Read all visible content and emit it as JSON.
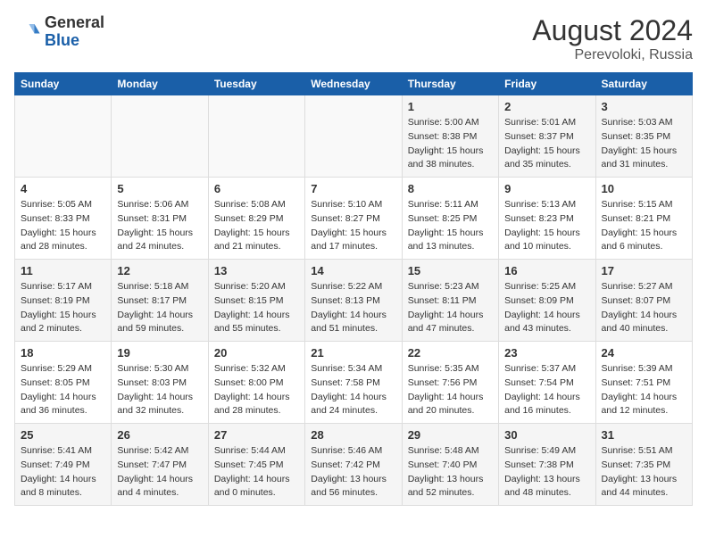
{
  "logo": {
    "text_general": "General",
    "text_blue": "Blue"
  },
  "title": {
    "month_year": "August 2024",
    "location": "Perevoloki, Russia"
  },
  "days_of_week": [
    "Sunday",
    "Monday",
    "Tuesday",
    "Wednesday",
    "Thursday",
    "Friday",
    "Saturday"
  ],
  "weeks": [
    [
      {
        "day": "",
        "info": ""
      },
      {
        "day": "",
        "info": ""
      },
      {
        "day": "",
        "info": ""
      },
      {
        "day": "",
        "info": ""
      },
      {
        "day": "1",
        "info": "Sunrise: 5:00 AM\nSunset: 8:38 PM\nDaylight: 15 hours\nand 38 minutes."
      },
      {
        "day": "2",
        "info": "Sunrise: 5:01 AM\nSunset: 8:37 PM\nDaylight: 15 hours\nand 35 minutes."
      },
      {
        "day": "3",
        "info": "Sunrise: 5:03 AM\nSunset: 8:35 PM\nDaylight: 15 hours\nand 31 minutes."
      }
    ],
    [
      {
        "day": "4",
        "info": "Sunrise: 5:05 AM\nSunset: 8:33 PM\nDaylight: 15 hours\nand 28 minutes."
      },
      {
        "day": "5",
        "info": "Sunrise: 5:06 AM\nSunset: 8:31 PM\nDaylight: 15 hours\nand 24 minutes."
      },
      {
        "day": "6",
        "info": "Sunrise: 5:08 AM\nSunset: 8:29 PM\nDaylight: 15 hours\nand 21 minutes."
      },
      {
        "day": "7",
        "info": "Sunrise: 5:10 AM\nSunset: 8:27 PM\nDaylight: 15 hours\nand 17 minutes."
      },
      {
        "day": "8",
        "info": "Sunrise: 5:11 AM\nSunset: 8:25 PM\nDaylight: 15 hours\nand 13 minutes."
      },
      {
        "day": "9",
        "info": "Sunrise: 5:13 AM\nSunset: 8:23 PM\nDaylight: 15 hours\nand 10 minutes."
      },
      {
        "day": "10",
        "info": "Sunrise: 5:15 AM\nSunset: 8:21 PM\nDaylight: 15 hours\nand 6 minutes."
      }
    ],
    [
      {
        "day": "11",
        "info": "Sunrise: 5:17 AM\nSunset: 8:19 PM\nDaylight: 15 hours\nand 2 minutes."
      },
      {
        "day": "12",
        "info": "Sunrise: 5:18 AM\nSunset: 8:17 PM\nDaylight: 14 hours\nand 59 minutes."
      },
      {
        "day": "13",
        "info": "Sunrise: 5:20 AM\nSunset: 8:15 PM\nDaylight: 14 hours\nand 55 minutes."
      },
      {
        "day": "14",
        "info": "Sunrise: 5:22 AM\nSunset: 8:13 PM\nDaylight: 14 hours\nand 51 minutes."
      },
      {
        "day": "15",
        "info": "Sunrise: 5:23 AM\nSunset: 8:11 PM\nDaylight: 14 hours\nand 47 minutes."
      },
      {
        "day": "16",
        "info": "Sunrise: 5:25 AM\nSunset: 8:09 PM\nDaylight: 14 hours\nand 43 minutes."
      },
      {
        "day": "17",
        "info": "Sunrise: 5:27 AM\nSunset: 8:07 PM\nDaylight: 14 hours\nand 40 minutes."
      }
    ],
    [
      {
        "day": "18",
        "info": "Sunrise: 5:29 AM\nSunset: 8:05 PM\nDaylight: 14 hours\nand 36 minutes."
      },
      {
        "day": "19",
        "info": "Sunrise: 5:30 AM\nSunset: 8:03 PM\nDaylight: 14 hours\nand 32 minutes."
      },
      {
        "day": "20",
        "info": "Sunrise: 5:32 AM\nSunset: 8:00 PM\nDaylight: 14 hours\nand 28 minutes."
      },
      {
        "day": "21",
        "info": "Sunrise: 5:34 AM\nSunset: 7:58 PM\nDaylight: 14 hours\nand 24 minutes."
      },
      {
        "day": "22",
        "info": "Sunrise: 5:35 AM\nSunset: 7:56 PM\nDaylight: 14 hours\nand 20 minutes."
      },
      {
        "day": "23",
        "info": "Sunrise: 5:37 AM\nSunset: 7:54 PM\nDaylight: 14 hours\nand 16 minutes."
      },
      {
        "day": "24",
        "info": "Sunrise: 5:39 AM\nSunset: 7:51 PM\nDaylight: 14 hours\nand 12 minutes."
      }
    ],
    [
      {
        "day": "25",
        "info": "Sunrise: 5:41 AM\nSunset: 7:49 PM\nDaylight: 14 hours\nand 8 minutes."
      },
      {
        "day": "26",
        "info": "Sunrise: 5:42 AM\nSunset: 7:47 PM\nDaylight: 14 hours\nand 4 minutes."
      },
      {
        "day": "27",
        "info": "Sunrise: 5:44 AM\nSunset: 7:45 PM\nDaylight: 14 hours\nand 0 minutes."
      },
      {
        "day": "28",
        "info": "Sunrise: 5:46 AM\nSunset: 7:42 PM\nDaylight: 13 hours\nand 56 minutes."
      },
      {
        "day": "29",
        "info": "Sunrise: 5:48 AM\nSunset: 7:40 PM\nDaylight: 13 hours\nand 52 minutes."
      },
      {
        "day": "30",
        "info": "Sunrise: 5:49 AM\nSunset: 7:38 PM\nDaylight: 13 hours\nand 48 minutes."
      },
      {
        "day": "31",
        "info": "Sunrise: 5:51 AM\nSunset: 7:35 PM\nDaylight: 13 hours\nand 44 minutes."
      }
    ]
  ]
}
